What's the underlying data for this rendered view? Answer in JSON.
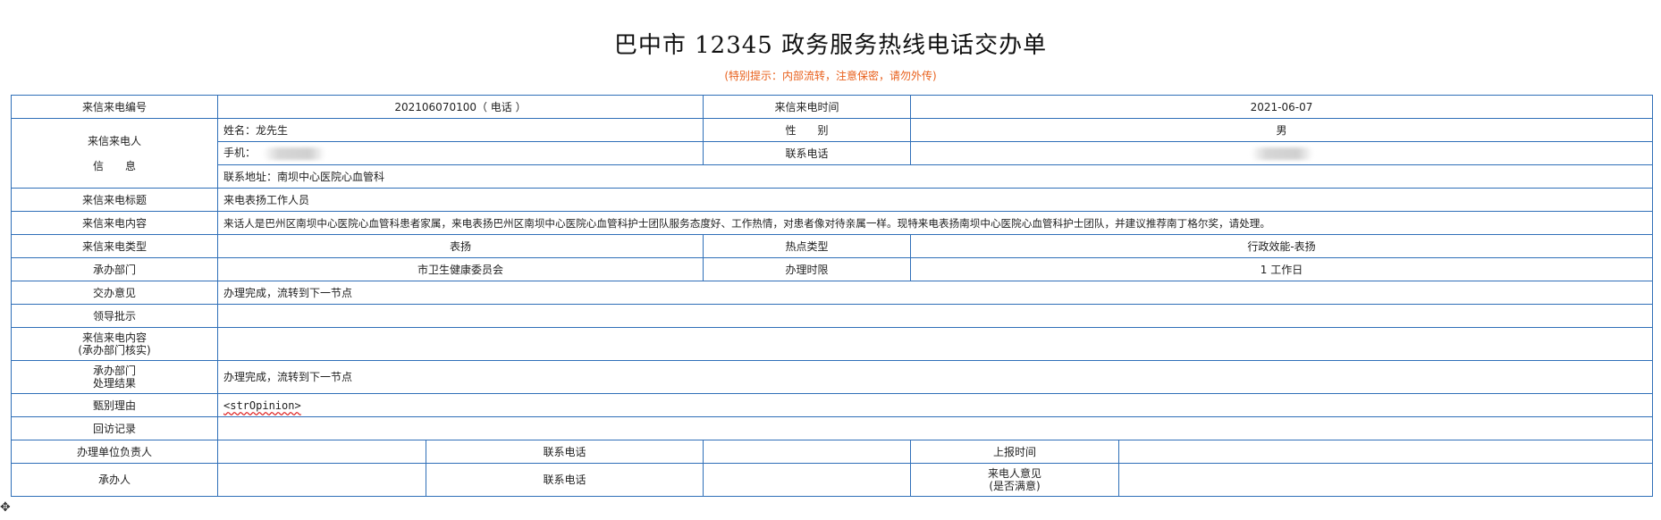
{
  "title": "巴中市 12345 政务服务热线电话交办单",
  "notice": "(特别提示：内部流转，注意保密，请勿外传)",
  "rows": {
    "letter_no": {
      "label": "来信来电编号",
      "value": "202106070100（ 电话 ）",
      "time_label": "来信来电时间",
      "time_value": "2021-06-07"
    },
    "caller": {
      "label_line1": "来信来电人",
      "label_line2": "信　　息",
      "name": "姓名：龙先生",
      "gender_label": "性　　别",
      "gender_value": "男",
      "mobile_label": "手机：",
      "phone_label": "联系电话",
      "address": "联系地址：南坝中心医院心血管科"
    },
    "subject": {
      "label": "来信来电标题",
      "value": "来电表扬工作人员"
    },
    "content": {
      "label": "来信来电内容",
      "value": "来话人是巴州区南坝中心医院心血管科患者家属，来电表扬巴州区南坝中心医院心血管科护士团队服务态度好、工作热情，对患者像对待亲属一样。现特来电表扬南坝中心医院心血管科护士团队，并建议推荐南丁格尔奖，请处理。"
    },
    "type": {
      "label": "来信来电类型",
      "value": "表扬",
      "hot_label": "热点类型",
      "hot_value": "行政效能-表扬"
    },
    "dept": {
      "label": "承办部门",
      "value": "市卫生健康委员会",
      "limit_label": "办理时限",
      "limit_value": "1 工作日"
    },
    "assign": {
      "label": "交办意见",
      "value": "办理完成，流转到下一节点"
    },
    "leader": {
      "label": "领导批示",
      "value": ""
    },
    "verify": {
      "label_line1": "来信来电内容",
      "label_line2": "(承办部门核实)",
      "value": ""
    },
    "result": {
      "label_line1": "承办部门",
      "label_line2": "处理结果",
      "value": "办理完成，流转到下一节点"
    },
    "reason": {
      "label": "甄别理由",
      "value": "<strOpinion>"
    },
    "revisit": {
      "label": "回访记录",
      "value": ""
    },
    "owner": {
      "label": "办理单位负责人",
      "phone_label": "联系电话",
      "report_label": "上报时间"
    },
    "handler": {
      "label": "承办人",
      "phone_label": "联系电话",
      "opinion_line1": "来电人意见",
      "opinion_line2": "(是否满意)"
    }
  },
  "colors": {
    "border": "#2f6fb8",
    "notice": "#e8601c"
  },
  "icons": {
    "cursor": "move-cursor-icon"
  }
}
